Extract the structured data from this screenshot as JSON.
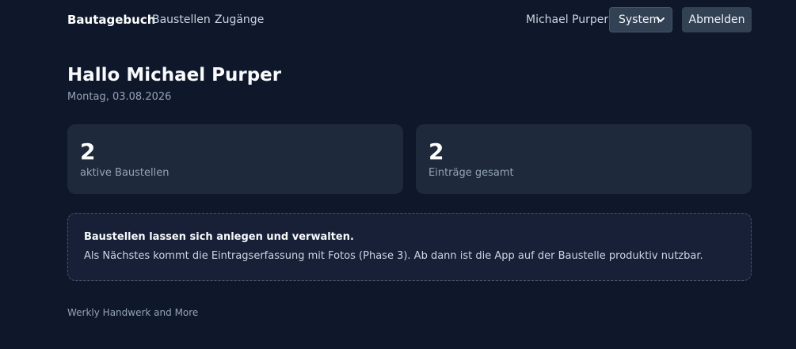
{
  "navbar": {
    "brand": "Bautagebuch",
    "links": [
      {
        "label": "Baustellen"
      },
      {
        "label": "Zugänge"
      }
    ],
    "user_name": "Michael Purper",
    "theme_select": {
      "selected": "System"
    },
    "logout_label": "Abmelden"
  },
  "main": {
    "greeting": "Hallo Michael Purper",
    "date": "Montag, 03.08.2026",
    "stats": [
      {
        "value": "2",
        "label": "aktive Baustellen"
      },
      {
        "value": "2",
        "label": "Einträge gesamt"
      }
    ],
    "info": {
      "title": "Baustellen lassen sich anlegen und verwalten.",
      "text": "Als Nächstes kommt die Eintragserfassung mit Fotos (Phase 3). Ab dann ist die App auf der Baustelle produktiv nutzbar."
    }
  },
  "footer": {
    "text": "Werkly Handwerk and More"
  },
  "colors": {
    "background": "#0f172a",
    "card": "#1e293b",
    "button": "#334155",
    "muted_text": "#94a3b8"
  },
  "icons": {
    "select_chevron": "chevron-down-icon"
  }
}
